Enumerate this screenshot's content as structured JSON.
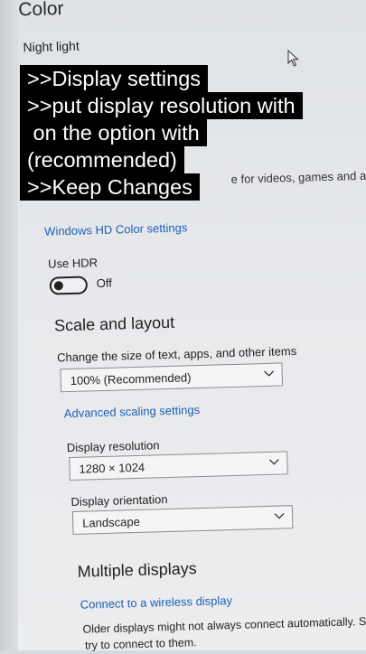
{
  "settings": {
    "section_title": "Color",
    "night_light_label": "Night light",
    "hdr_desc_fragment": "e for videos, games and app",
    "hdr_settings_link": "Windows HD Color settings",
    "use_hdr_label": "Use HDR",
    "use_hdr_state": "Off",
    "scale_heading": "Scale and layout",
    "size_label": "Change the size of text, apps, and other items",
    "size_value": "100% (Recommended)",
    "advanced_scaling_link": "Advanced scaling settings",
    "resolution_label": "Display resolution",
    "resolution_value": "1280 × 1024",
    "orientation_label": "Display orientation",
    "orientation_value": "Landscape",
    "multi_heading": "Multiple displays",
    "wireless_link": "Connect to a wireless display",
    "older_text_1": "Older displays might not always connect automatically. Select",
    "older_text_2": "try to connect to them."
  },
  "overlay": {
    "lines": [
      ">>Display settings",
      ">>put display resolution with",
      " on the option with",
      "(recommended)",
      ">>Keep Changes"
    ]
  },
  "icons": {
    "dropdown": "chevron-down-icon",
    "cursor": "mouse-pointer-icon"
  },
  "colors": {
    "link": "#1f5fb3",
    "overlay_bg": "#000000",
    "overlay_text": "#ffffff"
  }
}
